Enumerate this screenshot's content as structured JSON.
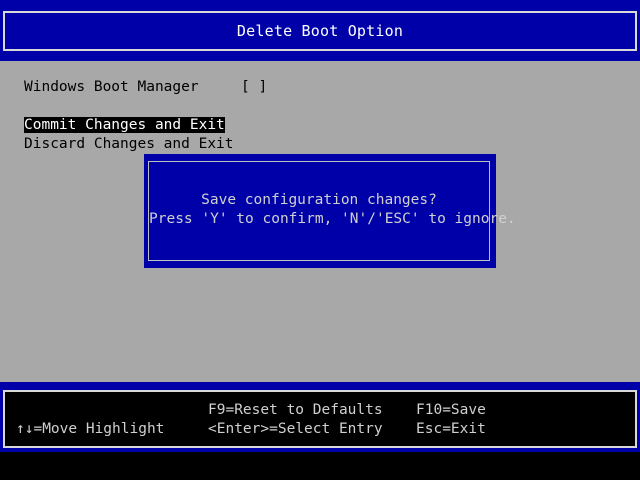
{
  "header": {
    "title": "Delete Boot Option"
  },
  "options": [
    {
      "label": "Windows Boot Manager",
      "checkbox": "[ ]"
    }
  ],
  "actions": [
    {
      "label": "Commit Changes and Exit",
      "highlighted": true
    },
    {
      "label": "Discard Changes and Exit",
      "highlighted": false
    }
  ],
  "dialog": {
    "line1": "Save configuration changes?",
    "line2": "Press 'Y' to confirm, 'N'/'ESC' to ignore."
  },
  "footer": {
    "move": "↑↓=Move Highlight",
    "reset": "F9=Reset to Defaults",
    "select": "<Enter>=Select Entry",
    "save": "F10=Save",
    "exit": "Esc=Exit"
  },
  "colors": {
    "bios_blue": "#0000a8",
    "body_gray": "#a8a8a8",
    "highlight_bg": "#000000"
  }
}
